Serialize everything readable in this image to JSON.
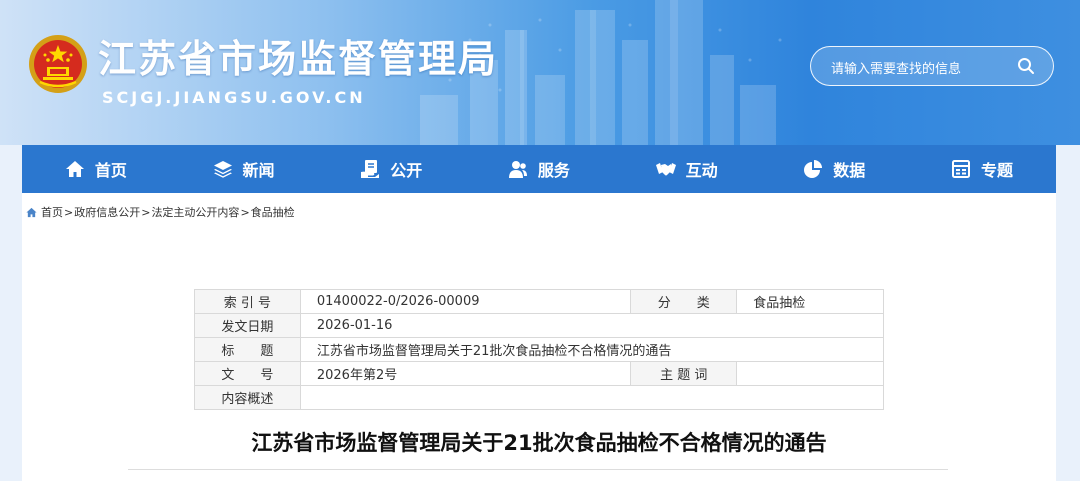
{
  "header": {
    "title": "江苏省市场监督管理局",
    "domain": "SCJGJ.JIANGSU.GOV.CN",
    "emblem_icon": "national-emblem-icon",
    "search": {
      "placeholder": "请输入需要查找的信息",
      "icon": "search-icon"
    }
  },
  "nav": {
    "items": [
      {
        "label": "首页",
        "icon": "home-icon"
      },
      {
        "label": "新闻",
        "icon": "layers-icon"
      },
      {
        "label": "公开",
        "icon": "document-hand-icon"
      },
      {
        "label": "服务",
        "icon": "people-icon"
      },
      {
        "label": "互动",
        "icon": "handshake-icon"
      },
      {
        "label": "数据",
        "icon": "pie-chart-icon"
      },
      {
        "label": "专题",
        "icon": "window-icon"
      }
    ]
  },
  "breadcrumb": {
    "items": [
      "首页",
      "政府信息公开",
      "法定主动公开内容",
      "食品抽检"
    ],
    "separator": ">"
  },
  "meta": {
    "index_label": "索 引 号",
    "index_value": "01400022-0/2026-00009",
    "category_label": "分　　类",
    "category_value": "食品抽检",
    "date_label": "发文日期",
    "date_value": "2026-01-16",
    "title_label": "标　　题",
    "title_value": "江苏省市场监督管理局关于21批次食品抽检不合格情况的通告",
    "docno_label": "文　　号",
    "docno_value": "2026年第2号",
    "keywords_label": "主 题 词",
    "keywords_value": "",
    "summary_label": "内容概述",
    "summary_value": ""
  },
  "article": {
    "title": "江苏省市场监督管理局关于21批次食品抽检不合格情况的通告"
  },
  "colors": {
    "nav_bg": "#2b77cf",
    "header_gradient_start": "#cfe2f7",
    "header_gradient_end": "#3e8fe0",
    "page_bg": "#e9f1fb"
  }
}
